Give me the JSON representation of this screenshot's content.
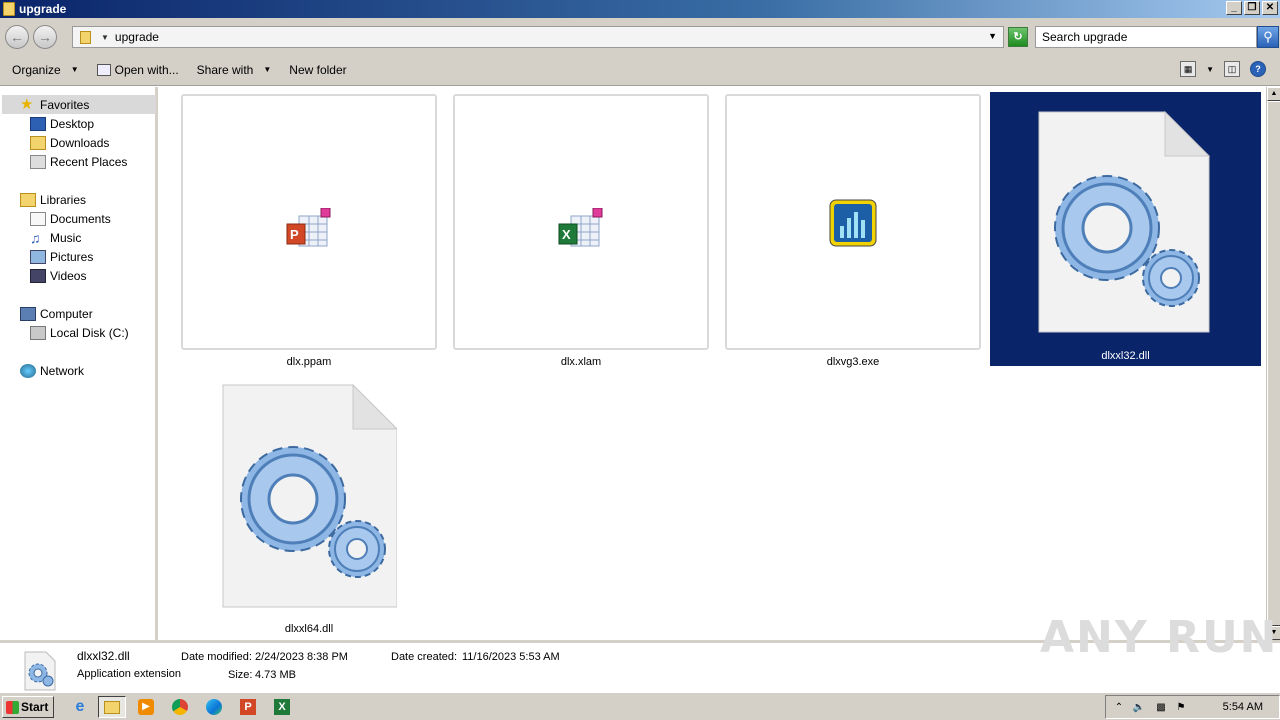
{
  "window": {
    "title": "upgrade",
    "buttons": [
      "_",
      "❐",
      "✕"
    ]
  },
  "address": {
    "path": "upgrade",
    "search_placeholder": "Search upgrade"
  },
  "toolbar": {
    "organize": "Organize",
    "open_with": "Open with...",
    "share_with": "Share with",
    "new_folder": "New folder"
  },
  "nav": {
    "favorites": "Favorites",
    "desktop": "Desktop",
    "downloads": "Downloads",
    "recent_places": "Recent Places",
    "libraries": "Libraries",
    "documents": "Documents",
    "music": "Music",
    "pictures": "Pictures",
    "videos": "Videos",
    "computer": "Computer",
    "local_disk": "Local Disk (C:)",
    "network": "Network"
  },
  "files": [
    {
      "name": "dlx.ppam",
      "icon": "powerpoint-addin-icon"
    },
    {
      "name": "dlx.xlam",
      "icon": "excel-addin-icon"
    },
    {
      "name": "dlxvg3.exe",
      "icon": "chart-app-icon"
    },
    {
      "name": "dlxxl32.dll",
      "icon": "dll-gear-icon",
      "selected": true
    },
    {
      "name": "dlxxl64.dll",
      "icon": "dll-gear-icon"
    }
  ],
  "details": {
    "name": "dlxxl32.dll",
    "type": "Application extension",
    "date_modified_label": "Date modified:",
    "date_modified": "2/24/2023 8:38 PM",
    "size_label": "Size:",
    "size": "4.73 MB",
    "date_created_label": "Date created:",
    "date_created": "11/16/2023 5:53 AM"
  },
  "watermark": "ANY RUN",
  "taskbar": {
    "start": "Start",
    "clock": "5:54 AM"
  },
  "colors": {
    "selection": "#0a246a",
    "chrome": "#d4d0c8"
  }
}
